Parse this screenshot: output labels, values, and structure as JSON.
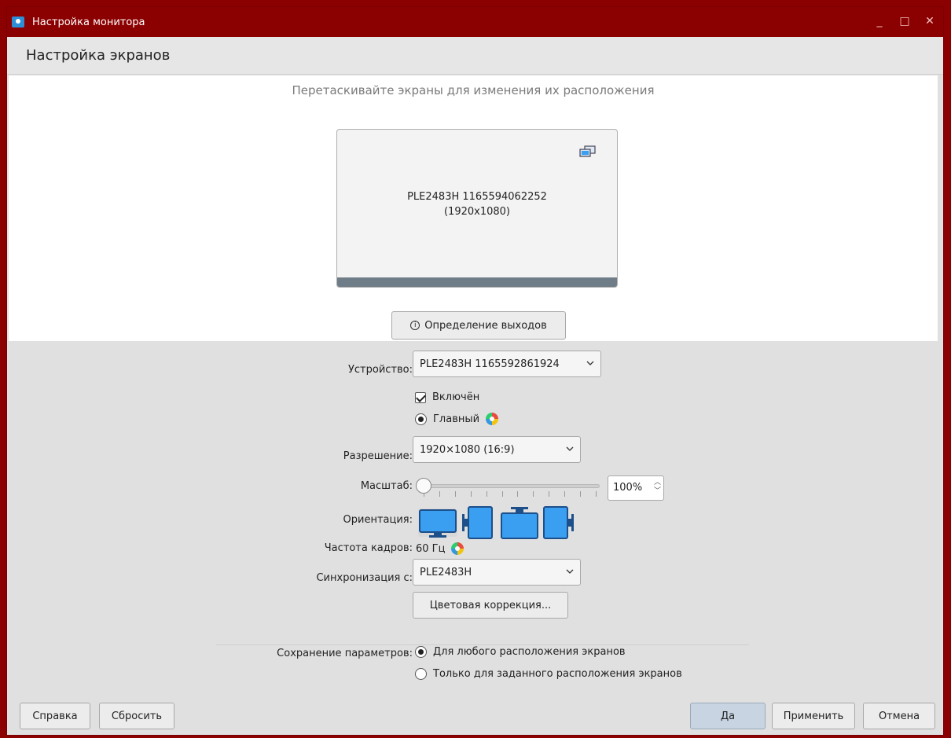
{
  "window": {
    "title": "Настройка монитора",
    "controls": [
      "_",
      "□",
      "✕"
    ]
  },
  "header": {
    "title": "Настройка экранов"
  },
  "arrangement": {
    "hint": "Перетаскивайте экраны для изменения их расположения",
    "screen_name": "PLE2483H 1165594062252",
    "screen_resolution": "(1920x1080)",
    "identify_label": "Определение выходов"
  },
  "form": {
    "device_label": "Устройство:",
    "device_value": "PLE2483H 1165592861924",
    "enabled_label": "Включён",
    "enabled_checked": true,
    "primary_label": "Главный",
    "primary_checked": true,
    "resolution_label": "Разрешение:",
    "resolution_value": "1920×1080 (16:9)",
    "scale_label": "Масштаб:",
    "scale_value": "100%",
    "scale_slider_fraction": 0.0,
    "orientation_label": "Ориентация:",
    "orientation_options": [
      "landscape",
      "portrait-left",
      "landscape-flipped",
      "portrait-right"
    ],
    "orientation_selected": "landscape",
    "refresh_label": "Частота кадров:",
    "refresh_value": "60 Гц",
    "sync_label": "Синхронизация с:",
    "sync_value": "PLE2483H",
    "color_button": "Цветовая коррекция...",
    "save_label": "Сохранение параметров:",
    "save_option_any": "Для любого расположения экранов",
    "save_option_specific": "Только для заданного расположения экранов",
    "save_selected": "any"
  },
  "footer": {
    "help": "Справка",
    "reset": "Сбросить",
    "ok": "Да",
    "apply": "Применить",
    "cancel": "Отмена"
  },
  "colors": {
    "titlebar": "#8b0000",
    "accent": "#3a9ff0",
    "primary_button": "#c8d4e2"
  }
}
